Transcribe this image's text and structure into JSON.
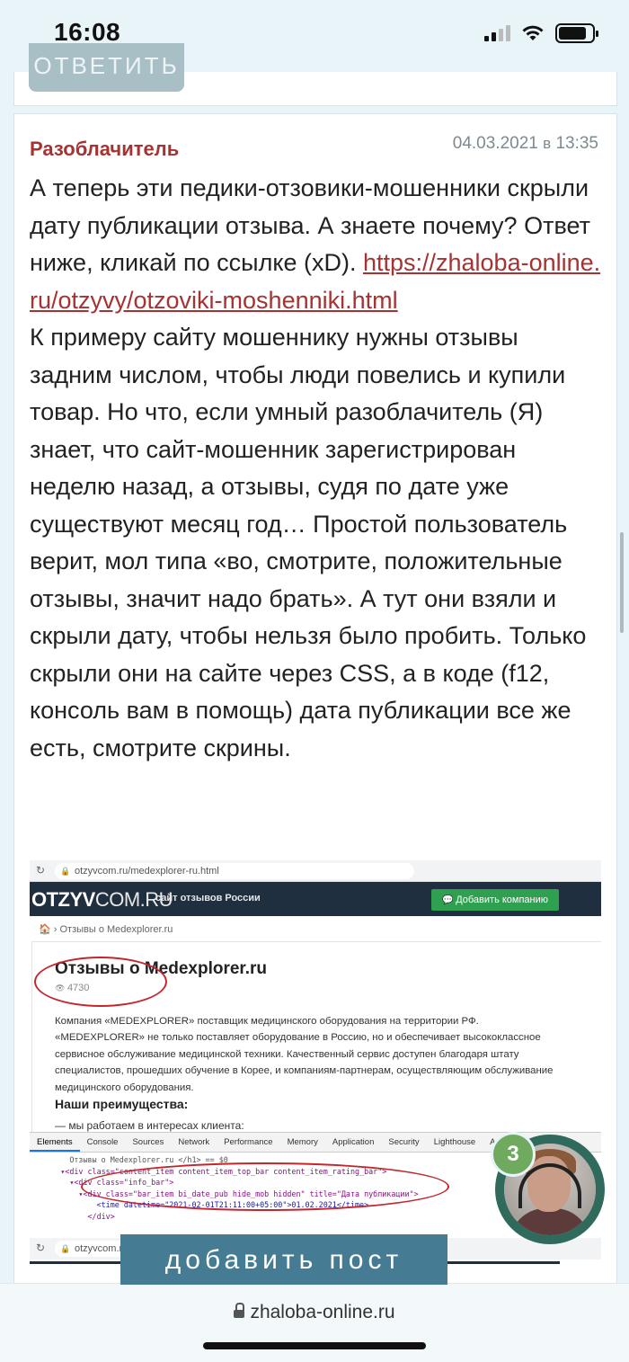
{
  "status_bar": {
    "time": "16:08"
  },
  "top": {
    "reply_label": "ОТВЕТИТЬ"
  },
  "comment": {
    "author": "Разоблачитель",
    "date": "04.03.2021",
    "date_sep": "в",
    "time": "13:35",
    "text_intro": "А теперь эти педики-отзовики-мошенники скрыли дату публикации отзыва. А знаете почему? Ответ ниже, кликай по ссылке (xD).",
    "link": "https://zhaloba-online.ru/otzyvy/otzoviki-moshenniki.html",
    "text_body": "К примеру сайту мошеннику нужны отзывы задним числом, чтобы люди повелись и купили товар. Но что, если умный разоблачитель (Я) знает, что сайт-мошенник зарегистрирован неделю назад, а отзывы, судя по дате уже существуют месяц год… Простой пользователь верит, мол типа «во, смотрите, положительные отзывы, значит надо брать». А тут они взяли и скрыли дату, чтобы нельзя было пробить. Только скрыли они на сайте через CSS, а в коде (f12, консоль вам в помощь) дата публикации все же есть, смотрите скрины."
  },
  "screenshot": {
    "url": "otzyvcom.ru/medexplorer-ru.html",
    "logo_bold": "OTZYV",
    "logo_thin": "COM.RU",
    "tagline": "сайт отзывов России",
    "add_company": "Добавить компанию",
    "breadcrumb": "🏠 › Отзывы о Medexplorer.ru",
    "title": "Отзывы о Medexplorer.ru",
    "views": "4730",
    "description": "Компания «MEDEXPLORER» поставщик медицинского оборудования на территории РФ. «MEDEXPLORER» не только поставляет оборудование в Россию, но и обеспечивает высококлассное сервисное обслуживание медицинской техники. Качественный сервис доступен благодаря штату специалистов, прошедших обучение в Корее, и компаниям-партнерам, осуществляющим обслуживание медицинского оборудования.",
    "advantages": "Наши преимущества:",
    "list_item": "— мы работаем в интересах клиента:",
    "devtools_tabs": [
      "Elements",
      "Console",
      "Sources",
      "Network",
      "Performance",
      "Memory",
      "Application",
      "Security",
      "Lighthouse",
      "AdBlock"
    ],
    "code_lines": [
      "        Отзывы о Medexplorer.ru </h1> == $0",
      "      ▾<div class=\"content_item content_item_top_bar content_item_rating_bar\">",
      "        ▾<div class=\"info_bar\">",
      "          ▾<div class=\"bar_item bi_date_pub hide_mob hidden\" title=\"Дата публикации\">",
      "              <time datetime=\"2021-02-01T21:11:00+05:00\">01.02.2021</time>",
      "            </div>"
    ],
    "url2": "otzyvcom.ru"
  },
  "add_post_label": "добавить пост",
  "avatar_badge": "3",
  "bottom_bar": {
    "domain": "zhaloba-online.ru"
  }
}
